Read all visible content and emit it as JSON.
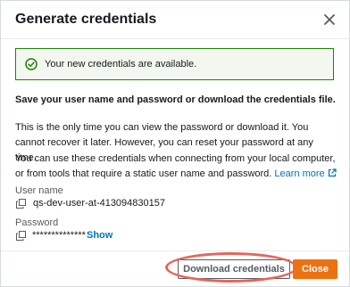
{
  "modal": {
    "title": "Generate credentials",
    "close_icon": "close-icon"
  },
  "alert": {
    "icon": "check-circle-icon",
    "text": "Your new credentials are available.",
    "color": "#1d8102"
  },
  "content": {
    "heading": "Save your user name and password or download the credentials file.",
    "para1": "This is the only time you can view the password or download it. You cannot recover it later. However, you can reset your password at any time.",
    "para2": "You can use these credentials when connecting from your local computer, or from tools that require a static user name and password.",
    "learn_more": "Learn more"
  },
  "fields": {
    "username_label": "User name",
    "username_value": "qs-dev-user-at-413094830157",
    "password_label": "Password",
    "password_value": "**************",
    "show_label": "Show"
  },
  "footer": {
    "download_label": "Download credentials",
    "close_label": "Close",
    "primary_color": "#ec7211",
    "highlight_color": "#e4675a"
  }
}
